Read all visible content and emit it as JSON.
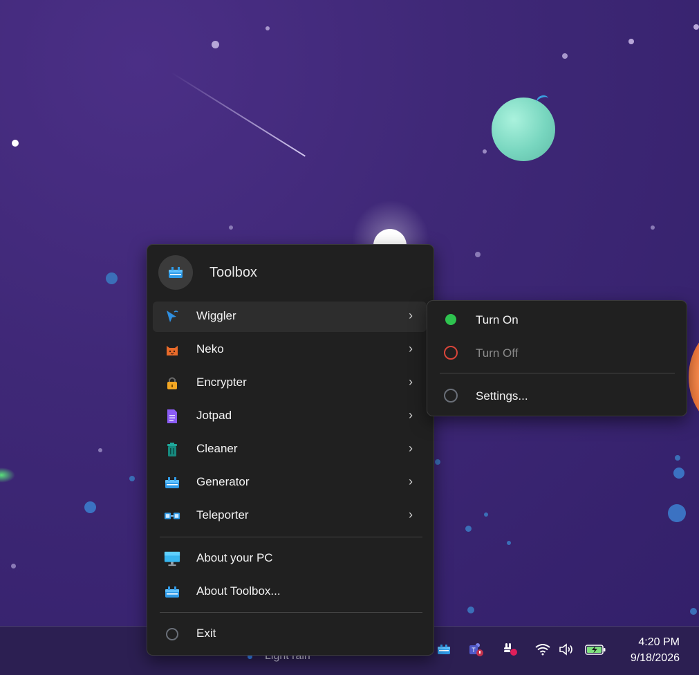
{
  "menu": {
    "title": "Toolbox",
    "items": [
      {
        "label": "Wiggler",
        "icon": "cursor-icon",
        "submenu": true
      },
      {
        "label": "Neko",
        "icon": "cat-icon",
        "submenu": true
      },
      {
        "label": "Encrypter",
        "icon": "lock-icon",
        "submenu": true
      },
      {
        "label": "Jotpad",
        "icon": "document-icon",
        "submenu": true
      },
      {
        "label": "Cleaner",
        "icon": "trash-icon",
        "submenu": true
      },
      {
        "label": "Generator",
        "icon": "toolbox-icon",
        "submenu": true
      },
      {
        "label": "Teleporter",
        "icon": "teleporter-icon",
        "submenu": true
      }
    ],
    "about_pc": "About your PC",
    "about_toolbox": "About Toolbox...",
    "exit": "Exit",
    "chevron": "›"
  },
  "submenu": {
    "turn_on": "Turn On",
    "turn_off": "Turn Off",
    "settings": "Settings..."
  },
  "taskbar": {
    "weather": "Light rain",
    "time": "4:20 PM",
    "date": "9/18/2026"
  },
  "colors": {
    "accent_green": "#2ec34f",
    "off_red": "#d9453a",
    "menu_bg": "#202020"
  }
}
